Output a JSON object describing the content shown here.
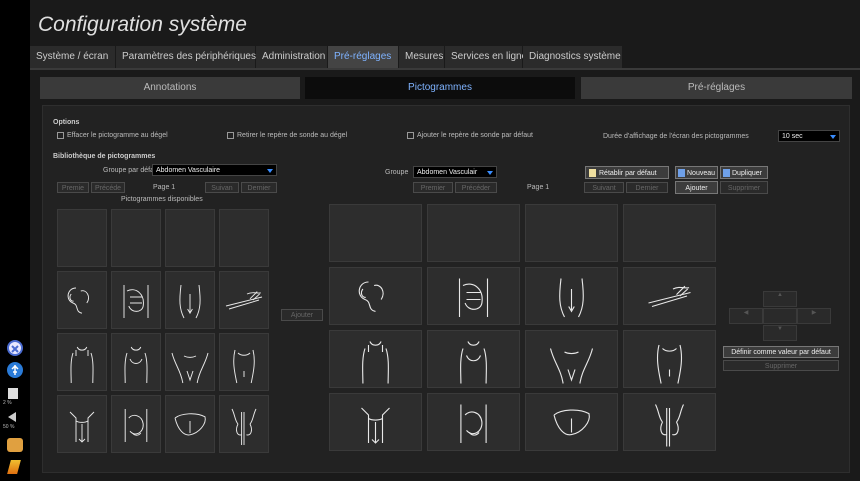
{
  "title": "Configuration système",
  "tabs": [
    {
      "label": "Système / écran"
    },
    {
      "label": "Paramètres des périphériques"
    },
    {
      "label": "Administration"
    },
    {
      "label": "Pré-réglages"
    },
    {
      "label": "Mesures"
    },
    {
      "label": "Services en ligne"
    },
    {
      "label": "Diagnostics système"
    }
  ],
  "subtabs": [
    {
      "label": "Annotations"
    },
    {
      "label": "Pictogrammes"
    },
    {
      "label": "Pré-réglages"
    }
  ],
  "options": {
    "heading": "Options",
    "checkbox1": "Effacer le pictogramme au dégel",
    "checkbox2": "Retirer le repère de sonde au dégel",
    "checkbox3": "Ajouter le repère de sonde par défaut",
    "duration_label": "Durée d'affichage de l'écran des pictogrammes",
    "duration_value": "10 sec"
  },
  "library": {
    "heading": "Bibliothèque de pictogrammes",
    "left": {
      "group_label": "Groupe par défaut",
      "group_value": "Abdomen Vasculaire",
      "first": "Premie",
      "prev": "Précéde",
      "page": "Page 1",
      "next": "Suivan",
      "last": "Dernier",
      "available": "Pictogrammes disponibles"
    },
    "right": {
      "group_label": "Groupe",
      "group_value": "Abdomen Vasculair",
      "first": "Premier",
      "prev": "Précéder",
      "page": "Page 1",
      "next": "Suivant",
      "last": "Dernier",
      "reset": "Rétablir par défaut",
      "new": "Nouveau",
      "duplicate": "Dupliquer",
      "add": "Ajouter",
      "delete": "Supprimer"
    },
    "add_middle": "Ajouter",
    "set_default": "Définir comme valeur par défaut",
    "delete_bottom": "Supprimer"
  },
  "sidebar": {
    "icons": [
      {
        "name": "close-circle-icon"
      },
      {
        "name": "usb-icon"
      },
      {
        "name": "disk-icon",
        "text": "2 %"
      },
      {
        "name": "volume-icon",
        "text": "50 %"
      },
      {
        "name": "user-icon"
      },
      {
        "name": "brush-icon"
      }
    ]
  },
  "colors": {
    "accent": "#7fb3ff",
    "caret": "#3a8dff",
    "background": "#1a1a1a"
  }
}
